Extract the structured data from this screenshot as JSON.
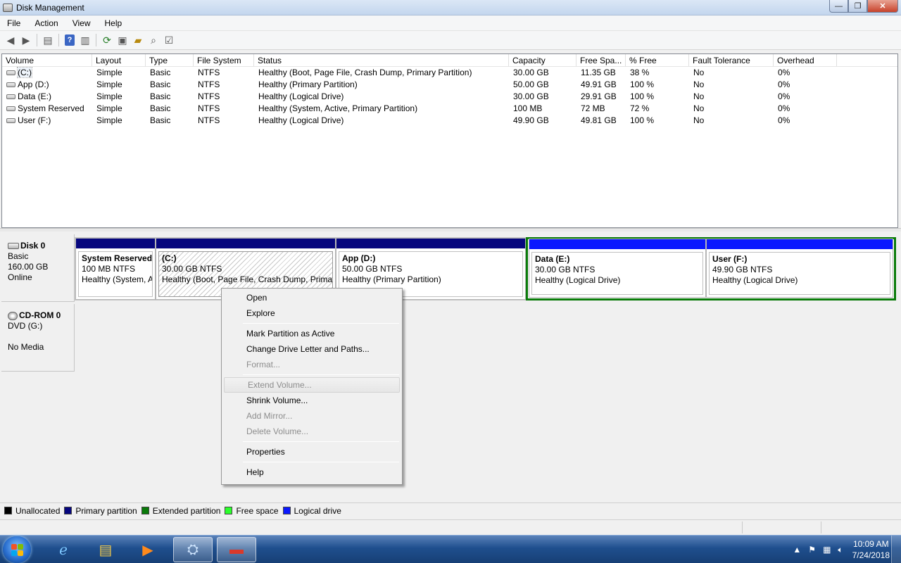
{
  "window": {
    "title": "Disk Management"
  },
  "menu": {
    "items": [
      "File",
      "Action",
      "View",
      "Help"
    ]
  },
  "columns": [
    "Volume",
    "Layout",
    "Type",
    "File System",
    "Status",
    "Capacity",
    "Free Spa...",
    "% Free",
    "Fault Tolerance",
    "Overhead"
  ],
  "volumes": [
    {
      "volume": "(C:)",
      "layout": "Simple",
      "type": "Basic",
      "fs": "NTFS",
      "status": "Healthy (Boot, Page File, Crash Dump, Primary Partition)",
      "capacity": "30.00 GB",
      "free": "11.35 GB",
      "pct": "38 %",
      "fault": "No",
      "overhead": "0%"
    },
    {
      "volume": "App (D:)",
      "layout": "Simple",
      "type": "Basic",
      "fs": "NTFS",
      "status": "Healthy (Primary Partition)",
      "capacity": "50.00 GB",
      "free": "49.91 GB",
      "pct": "100 %",
      "fault": "No",
      "overhead": "0%"
    },
    {
      "volume": "Data (E:)",
      "layout": "Simple",
      "type": "Basic",
      "fs": "NTFS",
      "status": "Healthy (Logical Drive)",
      "capacity": "30.00 GB",
      "free": "29.91 GB",
      "pct": "100 %",
      "fault": "No",
      "overhead": "0%"
    },
    {
      "volume": "System Reserved",
      "layout": "Simple",
      "type": "Basic",
      "fs": "NTFS",
      "status": "Healthy (System, Active, Primary Partition)",
      "capacity": "100 MB",
      "free": "72 MB",
      "pct": "72 %",
      "fault": "No",
      "overhead": "0%"
    },
    {
      "volume": "User (F:)",
      "layout": "Simple",
      "type": "Basic",
      "fs": "NTFS",
      "status": "Healthy (Logical Drive)",
      "capacity": "49.90 GB",
      "free": "49.81 GB",
      "pct": "100 %",
      "fault": "No",
      "overhead": "0%"
    }
  ],
  "disk0": {
    "name": "Disk 0",
    "kind": "Basic",
    "size": "160.00 GB",
    "state": "Online",
    "partitions": [
      {
        "name": "System Reserved",
        "size": "100 MB NTFS",
        "status": "Healthy (System, A"
      },
      {
        "name": "(C:)",
        "size": "30.00 GB NTFS",
        "status": "Healthy (Boot, Page File, Crash Dump, Primar"
      },
      {
        "name": "App  (D:)",
        "size": "50.00 GB NTFS",
        "status": "Healthy (Primary Partition)"
      },
      {
        "name": "Data  (E:)",
        "size": "30.00 GB NTFS",
        "status": "Healthy (Logical Drive)"
      },
      {
        "name": "User  (F:)",
        "size": "49.90 GB NTFS",
        "status": "Healthy (Logical Drive)"
      }
    ]
  },
  "cdrom": {
    "name": "CD-ROM 0",
    "drive": "DVD (G:)",
    "media": "No Media"
  },
  "legend": [
    {
      "label": "Unallocated",
      "color": "#000000"
    },
    {
      "label": "Primary partition",
      "color": "#06067e"
    },
    {
      "label": "Extended partition",
      "color": "#0a7b0a"
    },
    {
      "label": "Free space",
      "color": "#2bff2b"
    },
    {
      "label": "Logical drive",
      "color": "#0a18ff"
    }
  ],
  "context_menu": {
    "open": "Open",
    "explore": "Explore",
    "mark_active": "Mark Partition as Active",
    "change_letter": "Change Drive Letter and Paths...",
    "format": "Format...",
    "extend": "Extend Volume...",
    "shrink": "Shrink Volume...",
    "add_mirror": "Add Mirror...",
    "delete": "Delete Volume...",
    "properties": "Properties",
    "help": "Help"
  },
  "taskbar": {
    "time": "10:09 AM",
    "date": "7/24/2018"
  }
}
